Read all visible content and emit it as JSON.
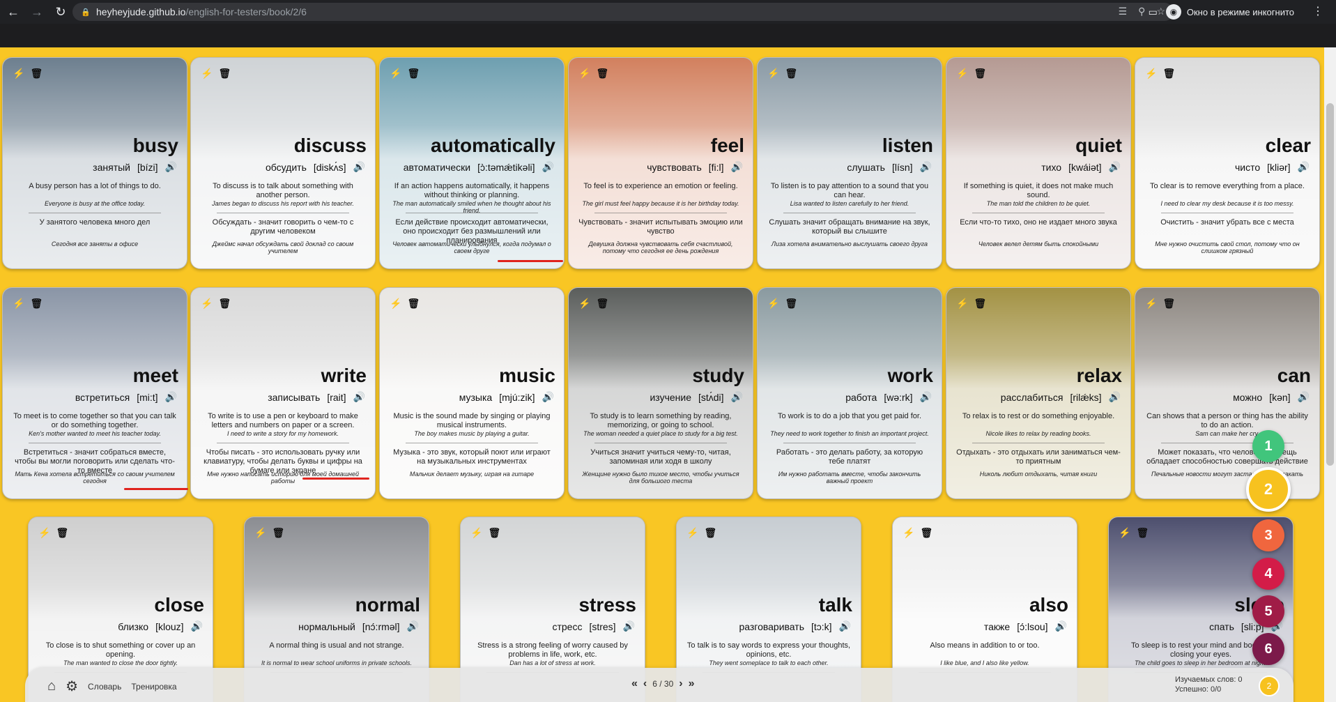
{
  "browser": {
    "url_host": "heyheyjude.github.io",
    "url_path": "/english-for-testers/book/2/6",
    "incognito_label": "Окно в режиме инкогнито"
  },
  "cards": [
    {
      "word": "busy",
      "translation": "занятый",
      "transcription": "[bízi]",
      "def_en": "A busy person has a lot of things to do.",
      "ex_en": "Everyone is busy at the office today.",
      "def_ru": "У занятого человека много дел",
      "ex_ru": "Сегодня все заняты в офисе",
      "color": "#6d7f8f"
    },
    {
      "word": "discuss",
      "translation": "обсудить",
      "transcription": "[diskʌ́s]",
      "def_en": "To discuss is to talk about something with another person.",
      "ex_en": "James began to discuss his report with his teacher.",
      "def_ru": "Обсуждать - значит говорить о чем-то с другим человеком",
      "ex_ru": "Джеймс начал обсуждать свой доклад со своим учителем",
      "color": "#cfd3d6"
    },
    {
      "word": "automatically",
      "translation": "автоматически",
      "transcription": "[ɔ̀:təmǽtikəli]",
      "def_en": "If an action happens automatically, it happens without thinking or planning.",
      "ex_en": "The man automatically smiled when he thought about his friend.",
      "def_ru": "Если действие происходит автоматически, оно происходит без размышлений или планирования",
      "ex_ru": "Человек автоматически улыбнулся, когда подумал о своем друге",
      "color": "#6e9fb0"
    },
    {
      "word": "feel",
      "translation": "чувствовать",
      "transcription": "[fi:l]",
      "def_en": "To feel is to experience an emotion or feeling.",
      "ex_en": "The girl must feel happy because it is her birthday today.",
      "def_ru": "Чувствовать - значит испытывать эмоцию или чувство",
      "ex_ru": "Девушка должна чувствовать себя счастливой, потому что сегодня ее день рождения",
      "color": "#d2805e"
    },
    {
      "word": "listen",
      "translation": "слушать",
      "transcription": "[lísn]",
      "def_en": "To listen is to pay attention to a sound that you can hear.",
      "ex_en": "Lisa wanted to listen carefully to her friend.",
      "def_ru": "Слушать значит обращать внимание на звук, который вы слышите",
      "ex_ru": "Лиза хотела внимательно выслушать своего друга",
      "color": "#8a9aa5"
    },
    {
      "word": "quiet",
      "translation": "тихо",
      "transcription": "[kwáiət]",
      "def_en": "If something is quiet, it does not make much sound.",
      "ex_en": "The man told the children to be quiet.",
      "def_ru": "Если что-то тихо, оно не издает много звука",
      "ex_ru": "Человек велел детям быть спокойными",
      "color": "#b59a93"
    },
    {
      "word": "clear",
      "translation": "чисто",
      "transcription": "[kliər]",
      "def_en": "To clear is to remove everything from a place.",
      "ex_en": "I need to clear my desk because it is too messy.",
      "def_ru": "Очистить - значит убрать все с места",
      "ex_ru": "Мне нужно очистить свой стол, потому что он слишком грязный",
      "color": "#dcdcdc"
    },
    {
      "word": "meet",
      "translation": "встретиться",
      "transcription": "[mi:t]",
      "def_en": "To meet is to come together so that you can talk or do something together.",
      "ex_en": "Ken's mother wanted to meet his teacher today.",
      "def_ru": "Встретиться - значит собраться вместе, чтобы вы могли поговорить или сделать что-то вместе",
      "ex_ru": "Мать Кена хотела встретиться со своим учителем сегодня",
      "color": "#8a95a6"
    },
    {
      "word": "write",
      "translation": "записывать",
      "transcription": "[rait]",
      "def_en": "To write is to use a pen or keyboard to make letters and numbers on paper or a screen.",
      "ex_en": "I need to write a story for my homework.",
      "def_ru": "Чтобы писать - это использовать ручку или клавиатуру, чтобы делать буквы и цифры на бумаге или экране",
      "ex_ru": "Мне нужно написать историю для моей домашней работы",
      "color": "#d9d9d9"
    },
    {
      "word": "music",
      "translation": "музыка",
      "transcription": "[mjú:zik]",
      "def_en": "Music is the sound made by singing or playing musical instruments.",
      "ex_en": "The boy makes music by playing a guitar.",
      "def_ru": "Музыка - это звук, который поют или играют на музыкальных инструментах",
      "ex_ru": "Мальчик делает музыку, играя на гитаре",
      "color": "#e8e6e3"
    },
    {
      "word": "study",
      "translation": "изучение",
      "transcription": "[stʌ́di]",
      "def_en": "To study is to learn something by reading, memorizing, or going to school.",
      "ex_en": "The woman needed a quiet place to study for a big test.",
      "def_ru": "Учиться значит учиться чему-то, читая, запоминая или ходя в школу",
      "ex_ru": "Женщине нужно было тихое место, чтобы учиться для большого теста",
      "color": "#5b5e5c"
    },
    {
      "word": "work",
      "translation": "работа",
      "transcription": "[wə:rk]",
      "def_en": "To work is to do a job that you get paid for.",
      "ex_en": "They need to work together to finish an important project.",
      "def_ru": "Работать - это делать работу, за которую тебе платят",
      "ex_ru": "Им нужно работать вместе, чтобы закончить важный проект",
      "color": "#8a9aa0"
    },
    {
      "word": "relax",
      "translation": "расслабиться",
      "transcription": "[rilǽks]",
      "def_en": "To relax is to rest or do something enjoyable.",
      "ex_en": "Nicole likes to relax by reading books.",
      "def_ru": "Отдыхать - это отдыхать или заниматься чем-то приятным",
      "ex_ru": "Николь любит отдыхать, читая книги",
      "color": "#a39244"
    },
    {
      "word": "can",
      "translation": "можно",
      "transcription": "[kən]",
      "def_en": "Can shows that a person or thing has the ability to do an action.",
      "ex_en": "Sam can make her cry.",
      "def_ru": "Может показать, что человек или вещь обладает способностью совершать действие",
      "ex_ru": "Печальные новости могут заставить ее плакать",
      "color": "#8d8781"
    },
    {
      "word": "close",
      "translation": "близко",
      "transcription": "[klouz]",
      "def_en": "To close is to shut something or cover up an opening.",
      "ex_en": "The man wanted to close the door tightly.",
      "def_ru": "",
      "ex_ru": "",
      "color": "#cfcfcf"
    },
    {
      "word": "normal",
      "translation": "нормальный",
      "transcription": "[nɔ́:rməl]",
      "def_en": "A normal thing is usual and not strange.",
      "ex_en": "It is normal to wear school uniforms in private schools.",
      "def_ru": "",
      "ex_ru": "",
      "color": "#8b8d92"
    },
    {
      "word": "stress",
      "translation": "стресс",
      "transcription": "[stres]",
      "def_en": "Stress is a strong feeling of worry caused by problems in life, work, etc.",
      "ex_en": "Dan has a lot of stress at work.",
      "def_ru": "",
      "ex_ru": "",
      "color": "#d3d5d6"
    },
    {
      "word": "talk",
      "translation": "разговаривать",
      "transcription": "[tɔ:k]",
      "def_en": "To talk is to say words to express your thoughts, opinions, etc.",
      "ex_en": "They went someplace to talk to each other.",
      "def_ru": "",
      "ex_ru": "",
      "color": "#c7cdd2"
    },
    {
      "word": "also",
      "translation": "также",
      "transcription": "[ɔ́:lsou]",
      "def_en": "Also means in addition to or too.",
      "ex_en": "I like blue, and I also like yellow.",
      "def_ru": "",
      "ex_ru": "",
      "color": "#eeeeee"
    },
    {
      "word": "sleep",
      "translation": "спать",
      "transcription": "[sli:p]",
      "def_en": "To sleep is to rest your mind and body by closing your eyes.",
      "ex_en": "The child goes to sleep in her bedroom at night.",
      "def_ru": "",
      "ex_ru": "",
      "color": "#4d4f6e"
    }
  ],
  "levels": [
    {
      "label": "1",
      "color": "#41c57c"
    },
    {
      "label": "2",
      "color": "#f7c21f"
    },
    {
      "label": "3",
      "color": "#f0663e"
    },
    {
      "label": "4",
      "color": "#d31c48"
    },
    {
      "label": "5",
      "color": "#a01c47"
    },
    {
      "label": "6",
      "color": "#7c1a4a"
    }
  ],
  "bottom": {
    "dictionary_label": "Словарь",
    "training_label": "Тренировка",
    "page_indicator": "6 / 30",
    "learned_words": "Изучаемых слов: 0",
    "success": "Успешно: 0/0",
    "level_badge": "2"
  }
}
